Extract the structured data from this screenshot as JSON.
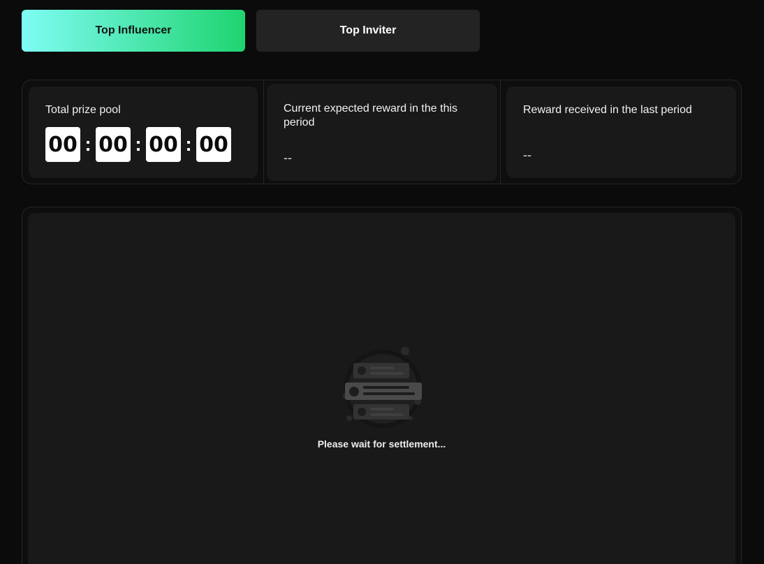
{
  "tabs": [
    {
      "label": "Top Influencer",
      "active": true
    },
    {
      "label": "Top Inviter",
      "active": false
    }
  ],
  "stats": {
    "prize_pool_label": "Total prize pool",
    "countdown": [
      "00",
      "00",
      "00",
      "00"
    ],
    "countdown_separator": ":",
    "expected_reward_label": "Current expected reward in the this period",
    "expected_reward_value": "--",
    "last_reward_label": "Reward received in the last period",
    "last_reward_value": "--"
  },
  "board": {
    "empty_icon": "empty-list-icon",
    "empty_message": "Please wait for settlement..."
  },
  "colors": {
    "background": "#0b0b0b",
    "card": "#191919",
    "accent_gradient_start": "#7ffcf4",
    "accent_gradient_end": "#1ed46f",
    "inactive_tab": "#232323"
  }
}
